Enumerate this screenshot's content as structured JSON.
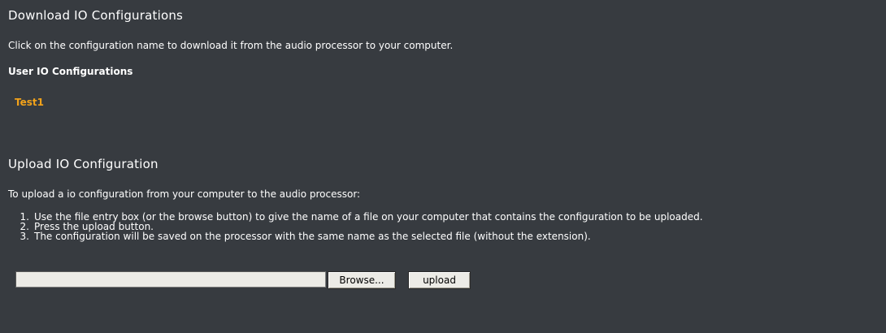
{
  "download": {
    "title": "Download IO Configurations",
    "description": "Click on the configuration name to download it from the audio processor to your computer.",
    "user_configs_heading": "User IO Configurations",
    "configs": [
      "Test1"
    ]
  },
  "upload": {
    "title": "Upload IO Configuration",
    "intro": "To upload a io configuration from your computer to the audio processor:",
    "steps": [
      {
        "num": "1.",
        "text": "Use the file entry box (or the browse button) to give the name of a file on your computer that contains the configuration to be uploaded."
      },
      {
        "num": "2.",
        "text": "Press the upload button."
      },
      {
        "num": "3.",
        "text": "The configuration will be saved on the processor with the same name as the selected file (without the extension)."
      }
    ],
    "file_value": "",
    "browse_label": "Browse...",
    "upload_label": "upload"
  },
  "colors": {
    "background": "#373b40",
    "text": "#ffffff",
    "link": "#f2a21a"
  }
}
